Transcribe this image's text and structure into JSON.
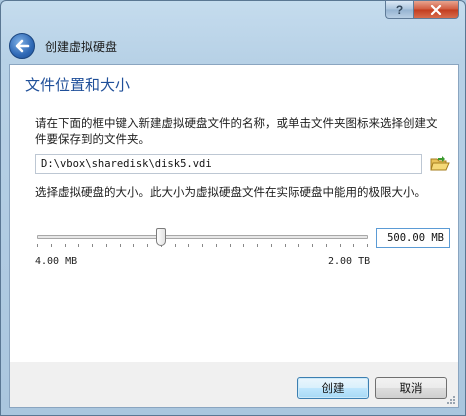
{
  "window": {
    "help_label": "?",
    "close_label": "x"
  },
  "header": {
    "title": "创建虚拟硬盘"
  },
  "section": {
    "title": "文件位置和大小",
    "location_text": "请在下面的框中键入新建虚拟硬盘文件的名称，或单击文件夹图标来选择创建文件要保存到的文件夹。",
    "file_path": "D:\\vbox\\sharedisk\\disk5.vdi",
    "size_text": "选择虚拟硬盘的大小。此大小为虚拟硬盘文件在实际硬盘中能用的极限大小。",
    "size_value": "500.00 MB",
    "size_min_label": "4.00 MB",
    "size_max_label": "2.00 TB",
    "slider_fraction": 0.37
  },
  "buttons": {
    "create_label": "创建",
    "cancel_label": "取消"
  },
  "colors": {
    "title_blue": "#1f4f99",
    "accent": "#3c7fb1"
  },
  "icons": {
    "back": "back-arrow-icon",
    "folder": "folder-open-icon",
    "grip": "resize-grip-icon"
  }
}
